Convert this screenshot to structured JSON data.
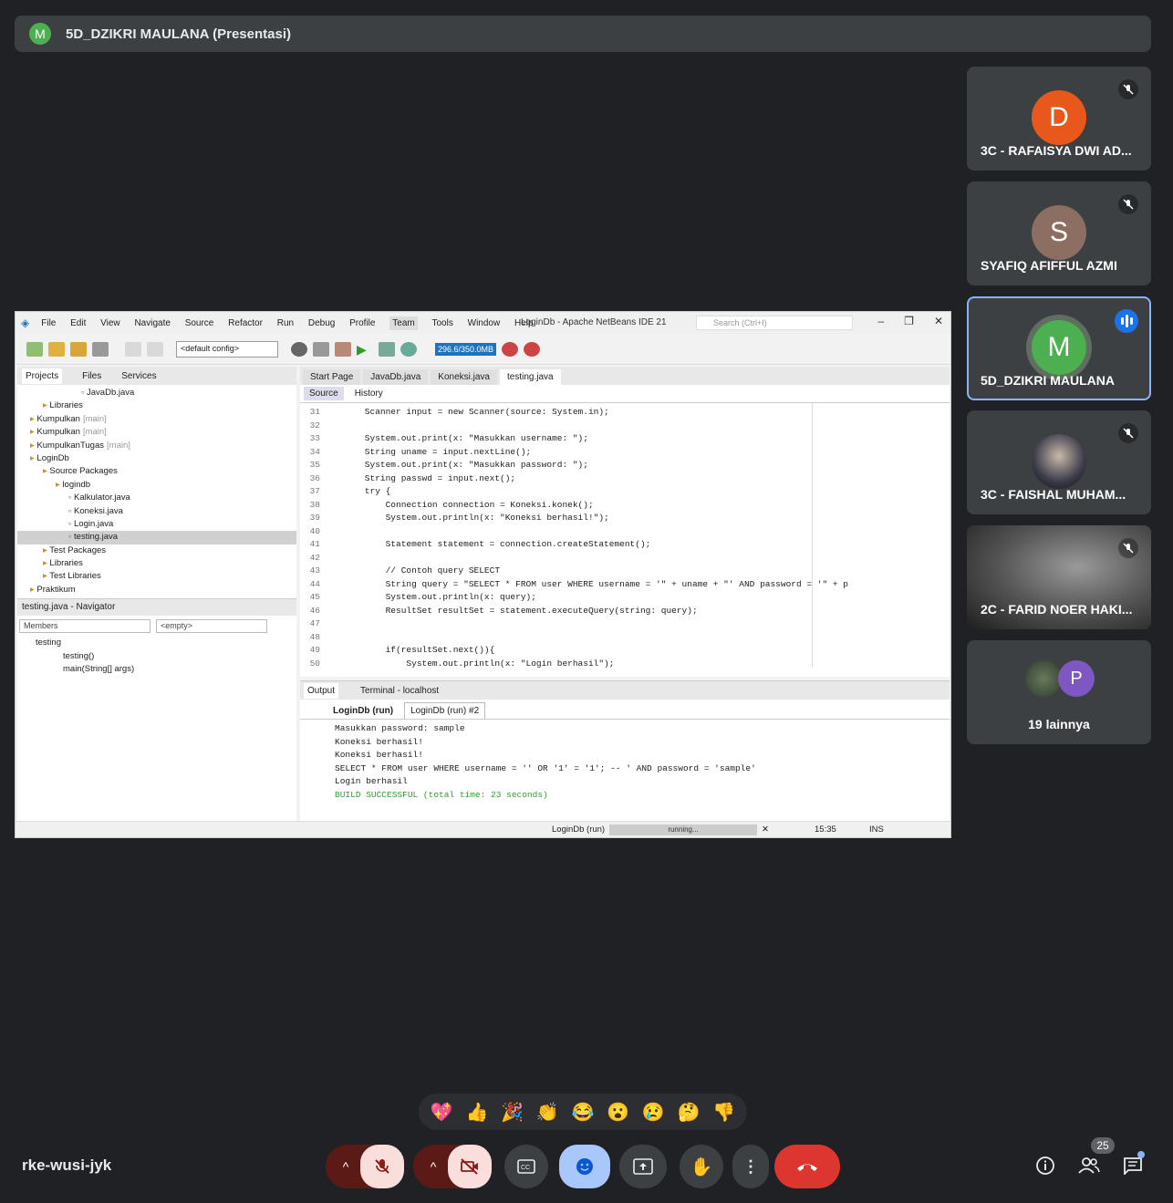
{
  "presenter_banner": {
    "avatar_letter": "M",
    "text": "5D_DZIKRI MAULANA (Presentasi)"
  },
  "participants": [
    {
      "initial": "D",
      "name": "3C - RAFAISYA DWI AD...",
      "color": "#e8581c",
      "muted": true
    },
    {
      "initial": "S",
      "name": "SYAFIQ AFIFFUL AZMI",
      "color": "#8d6e63",
      "muted": true
    },
    {
      "initial": "M",
      "name": "5D_DZIKRI MAULANA",
      "color": "#4caf50",
      "speaking": true
    },
    {
      "initial": "",
      "name": "3C - FAISHAL MUHAM...",
      "muted": true
    },
    {
      "initial": "",
      "name": "2C - FARID NOER HAKI...",
      "muted": true
    },
    {
      "initial": "P",
      "name": "19 lainnya",
      "color": "#7e57c2"
    }
  ],
  "netbeans": {
    "title": "LoginDb - Apache NetBeans IDE 21",
    "menu": [
      "File",
      "Edit",
      "View",
      "Navigate",
      "Source",
      "Refactor",
      "Run",
      "Debug",
      "Profile",
      "Team",
      "Tools",
      "Window",
      "Help"
    ],
    "search_placeholder": "Search (Ctrl+I)",
    "config": "<default config>",
    "memory": "296.6/350.0MB",
    "left_tabs": [
      "Projects",
      "Files",
      "Services"
    ],
    "tree": [
      {
        "indent": 5,
        "text": "JavaDb.java",
        "extra": ""
      },
      {
        "indent": 2,
        "text": "Libraries",
        "extra": ""
      },
      {
        "indent": 1,
        "text": "Kumpulkan",
        "extra": "[main]"
      },
      {
        "indent": 1,
        "text": "Kumpulkan",
        "extra": "[main]"
      },
      {
        "indent": 1,
        "text": "KumpulkanTugas",
        "extra": "[main]"
      },
      {
        "indent": 1,
        "text": "LoginDb",
        "extra": ""
      },
      {
        "indent": 2,
        "text": "Source Packages",
        "extra": ""
      },
      {
        "indent": 3,
        "text": "logindb",
        "extra": ""
      },
      {
        "indent": 4,
        "text": "Kalkulator.java",
        "extra": ""
      },
      {
        "indent": 4,
        "text": "Koneksi.java",
        "extra": ""
      },
      {
        "indent": 4,
        "text": "Login.java",
        "extra": ""
      },
      {
        "indent": 4,
        "text": "testing.java",
        "extra": "",
        "selected": true
      },
      {
        "indent": 2,
        "text": "Test Packages",
        "extra": ""
      },
      {
        "indent": 2,
        "text": "Libraries",
        "extra": ""
      },
      {
        "indent": 2,
        "text": "Test Libraries",
        "extra": ""
      },
      {
        "indent": 1,
        "text": "Praktikum",
        "extra": ""
      }
    ],
    "navigator": {
      "title": "testing.java - Navigator",
      "members": "Members",
      "empty": "<empty>",
      "items": [
        "testing",
        "testing()",
        "main(String[] args)"
      ]
    },
    "editor_tabs": [
      "Start Page",
      "JavaDb.java",
      "Koneksi.java",
      "testing.java"
    ],
    "editor_modes": [
      "Source",
      "History"
    ],
    "code_lines": [
      {
        "n": "31",
        "t": "    Scanner input = new Scanner(source: System.in);"
      },
      {
        "n": "32",
        "t": ""
      },
      {
        "n": "33",
        "t": "    System.out.print(x: \"Masukkan username: \");"
      },
      {
        "n": "34",
        "t": "    String uname = input.nextLine();"
      },
      {
        "n": "35",
        "t": "    System.out.print(x: \"Masukkan password: \");"
      },
      {
        "n": "36",
        "t": "    String passwd = input.next();"
      },
      {
        "n": "37",
        "t": "    try {"
      },
      {
        "n": "38",
        "t": "        Connection connection = Koneksi.konek();"
      },
      {
        "n": "39",
        "t": "        System.out.println(x: \"Koneksi berhasil!\");"
      },
      {
        "n": "40",
        "t": ""
      },
      {
        "n": "41",
        "t": "        Statement statement = connection.createStatement();"
      },
      {
        "n": "42",
        "t": ""
      },
      {
        "n": "43",
        "t": "        // Contoh query SELECT"
      },
      {
        "n": "44",
        "t": "        String query = \"SELECT * FROM user WHERE username = '\" + uname + \"' AND password = '\" + p"
      },
      {
        "n": "45",
        "t": "        System.out.println(x: query);"
      },
      {
        "n": "46",
        "t": "        ResultSet resultSet = statement.executeQuery(string: query);"
      },
      {
        "n": "47",
        "t": ""
      },
      {
        "n": "48",
        "t": ""
      },
      {
        "n": "49",
        "t": "        if(resultSet.next()){"
      },
      {
        "n": "50",
        "t": "            System.out.println(x: \"Login berhasil\");"
      }
    ],
    "output": {
      "tabs": [
        "Output",
        "Terminal - localhost"
      ],
      "subtabs": [
        "LoginDb (run)",
        "LoginDb (run) #2"
      ],
      "lines": [
        "Masukkan password: sample",
        "Koneksi berhasil!",
        "Koneksi berhasil!",
        "SELECT * FROM user WHERE username = '' OR '1' = '1'; -- ' AND password = 'sample'",
        "Login berhasil",
        "BUILD SUCCESSFUL (total time: 23 seconds)"
      ]
    },
    "status": {
      "task": "LoginDb (run)",
      "progress": "running...",
      "pos": "15:35",
      "mode": "INS"
    }
  },
  "reactions": [
    "💖",
    "👍",
    "🎉",
    "👏",
    "😂",
    "😮",
    "😢",
    "🤔",
    "👎"
  ],
  "meeting_code": "rke-wusi-jyk",
  "people_count": "25"
}
